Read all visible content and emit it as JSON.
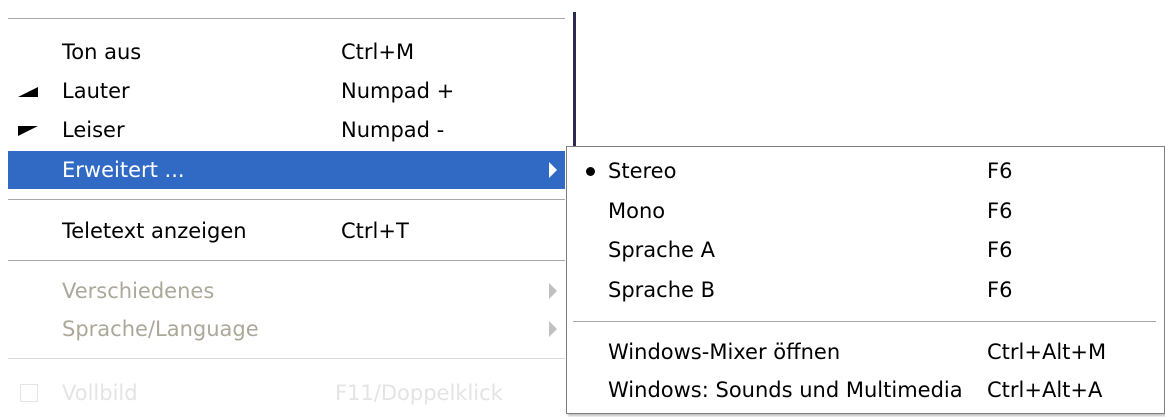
{
  "main_menu": {
    "items": [
      {
        "label": "Ton aus",
        "shortcut": "Ctrl+M"
      },
      {
        "label": "Lauter",
        "shortcut": "Numpad +",
        "icon": "volume-up-icon"
      },
      {
        "label": "Leiser",
        "shortcut": "Numpad -",
        "icon": "volume-down-icon"
      },
      {
        "label": "Erweitert ...",
        "shortcut": "",
        "submenu": true,
        "highlighted": true
      },
      {
        "label": "Teletext anzeigen",
        "shortcut": "Ctrl+T"
      },
      {
        "label": "Verschiedenes",
        "submenu": true,
        "disabled": true
      },
      {
        "label": "Sprache/Language",
        "submenu": true,
        "disabled": true
      },
      {
        "label": "Vollbild",
        "shortcut": "F11/Doppelklick",
        "disabled": true,
        "icon": "checkbox-icon"
      }
    ]
  },
  "submenu": {
    "items": [
      {
        "label": "Stereo",
        "shortcut": "F6",
        "selected": true
      },
      {
        "label": "Mono",
        "shortcut": "F6"
      },
      {
        "label": "Sprache A",
        "shortcut": "F6"
      },
      {
        "label": "Sprache B",
        "shortcut": "F6"
      },
      {
        "label": "Windows-Mixer öffnen",
        "shortcut": "Ctrl+Alt+M"
      },
      {
        "label": "Windows: Sounds und Multimedia",
        "shortcut": "Ctrl+Alt+A"
      }
    ]
  },
  "colors": {
    "highlight": "#316ac5",
    "disabled_text": "#aca899",
    "separator": "#a7a6aa"
  }
}
